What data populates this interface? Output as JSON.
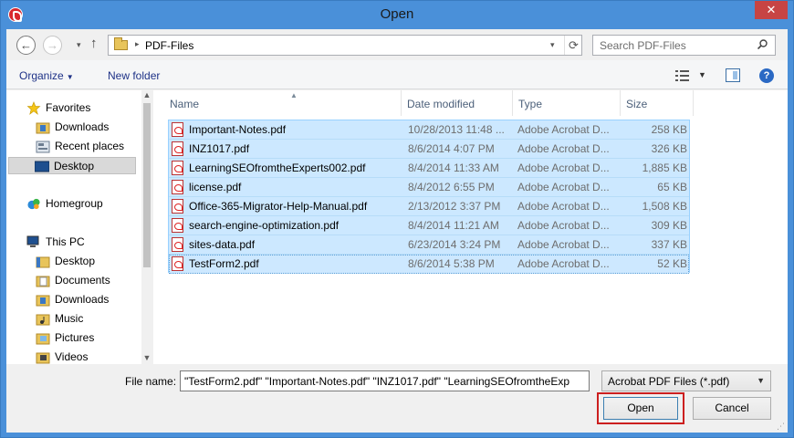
{
  "window": {
    "title": "Open",
    "close_label": "✕"
  },
  "nav": {
    "back_label": "←",
    "forward_label": "→",
    "up_label": "↑",
    "path": "PDF-Files",
    "search_placeholder": "Search PDF-Files"
  },
  "toolbar": {
    "organize_label": "Organize",
    "new_folder_label": "New folder",
    "help_label": "?"
  },
  "sidebar": {
    "items": [
      {
        "label": "Favorites",
        "icon": "star-icon"
      },
      {
        "label": "Downloads",
        "icon": "downloads-folder-icon"
      },
      {
        "label": "Recent places",
        "icon": "recent-places-icon"
      },
      {
        "label": "Desktop",
        "icon": "desktop-icon",
        "selected": true
      },
      {
        "label": "Homegroup",
        "icon": "homegroup-icon"
      },
      {
        "label": "This PC",
        "icon": "pc-icon"
      },
      {
        "label": "Desktop",
        "icon": "folder-icon"
      },
      {
        "label": "Documents",
        "icon": "folder-icon"
      },
      {
        "label": "Downloads",
        "icon": "folder-icon"
      },
      {
        "label": "Music",
        "icon": "folder-icon"
      },
      {
        "label": "Pictures",
        "icon": "folder-icon"
      },
      {
        "label": "Videos",
        "icon": "folder-icon"
      }
    ]
  },
  "columns": {
    "name": "Name",
    "date": "Date modified",
    "type": "Type",
    "size": "Size"
  },
  "files": [
    {
      "name": "Important-Notes.pdf",
      "date": "10/28/2013 11:48 ...",
      "type": "Adobe Acrobat D...",
      "size": "258 KB"
    },
    {
      "name": "INZ1017.pdf",
      "date": "8/6/2014 4:07 PM",
      "type": "Adobe Acrobat D...",
      "size": "326 KB"
    },
    {
      "name": "LearningSEOfromtheExperts002.pdf",
      "date": "8/4/2014 11:33 AM",
      "type": "Adobe Acrobat D...",
      "size": "1,885 KB"
    },
    {
      "name": "license.pdf",
      "date": "8/4/2012 6:55 PM",
      "type": "Adobe Acrobat D...",
      "size": "65 KB"
    },
    {
      "name": "Office-365-Migrator-Help-Manual.pdf",
      "date": "2/13/2012 3:37 PM",
      "type": "Adobe Acrobat D...",
      "size": "1,508 KB"
    },
    {
      "name": "search-engine-optimization.pdf",
      "date": "8/4/2014 11:21 AM",
      "type": "Adobe Acrobat D...",
      "size": "309 KB"
    },
    {
      "name": "sites-data.pdf",
      "date": "6/23/2014 3:24 PM",
      "type": "Adobe Acrobat D...",
      "size": "337 KB"
    },
    {
      "name": "TestForm2.pdf",
      "date": "8/6/2014 5:38 PM",
      "type": "Adobe Acrobat D...",
      "size": "52 KB"
    }
  ],
  "footer": {
    "file_name_label": "File name:",
    "file_name_value": "\"TestForm2.pdf\" \"Important-Notes.pdf\" \"INZ1017.pdf\" \"LearningSEOfromtheExp",
    "file_type_value": "Acrobat PDF Files (*.pdf)",
    "open_label": "Open",
    "cancel_label": "Cancel"
  },
  "colors": {
    "title_bar": "#4a90d9",
    "selection": "#cce8ff",
    "highlight_border": "#cc1f1f"
  }
}
